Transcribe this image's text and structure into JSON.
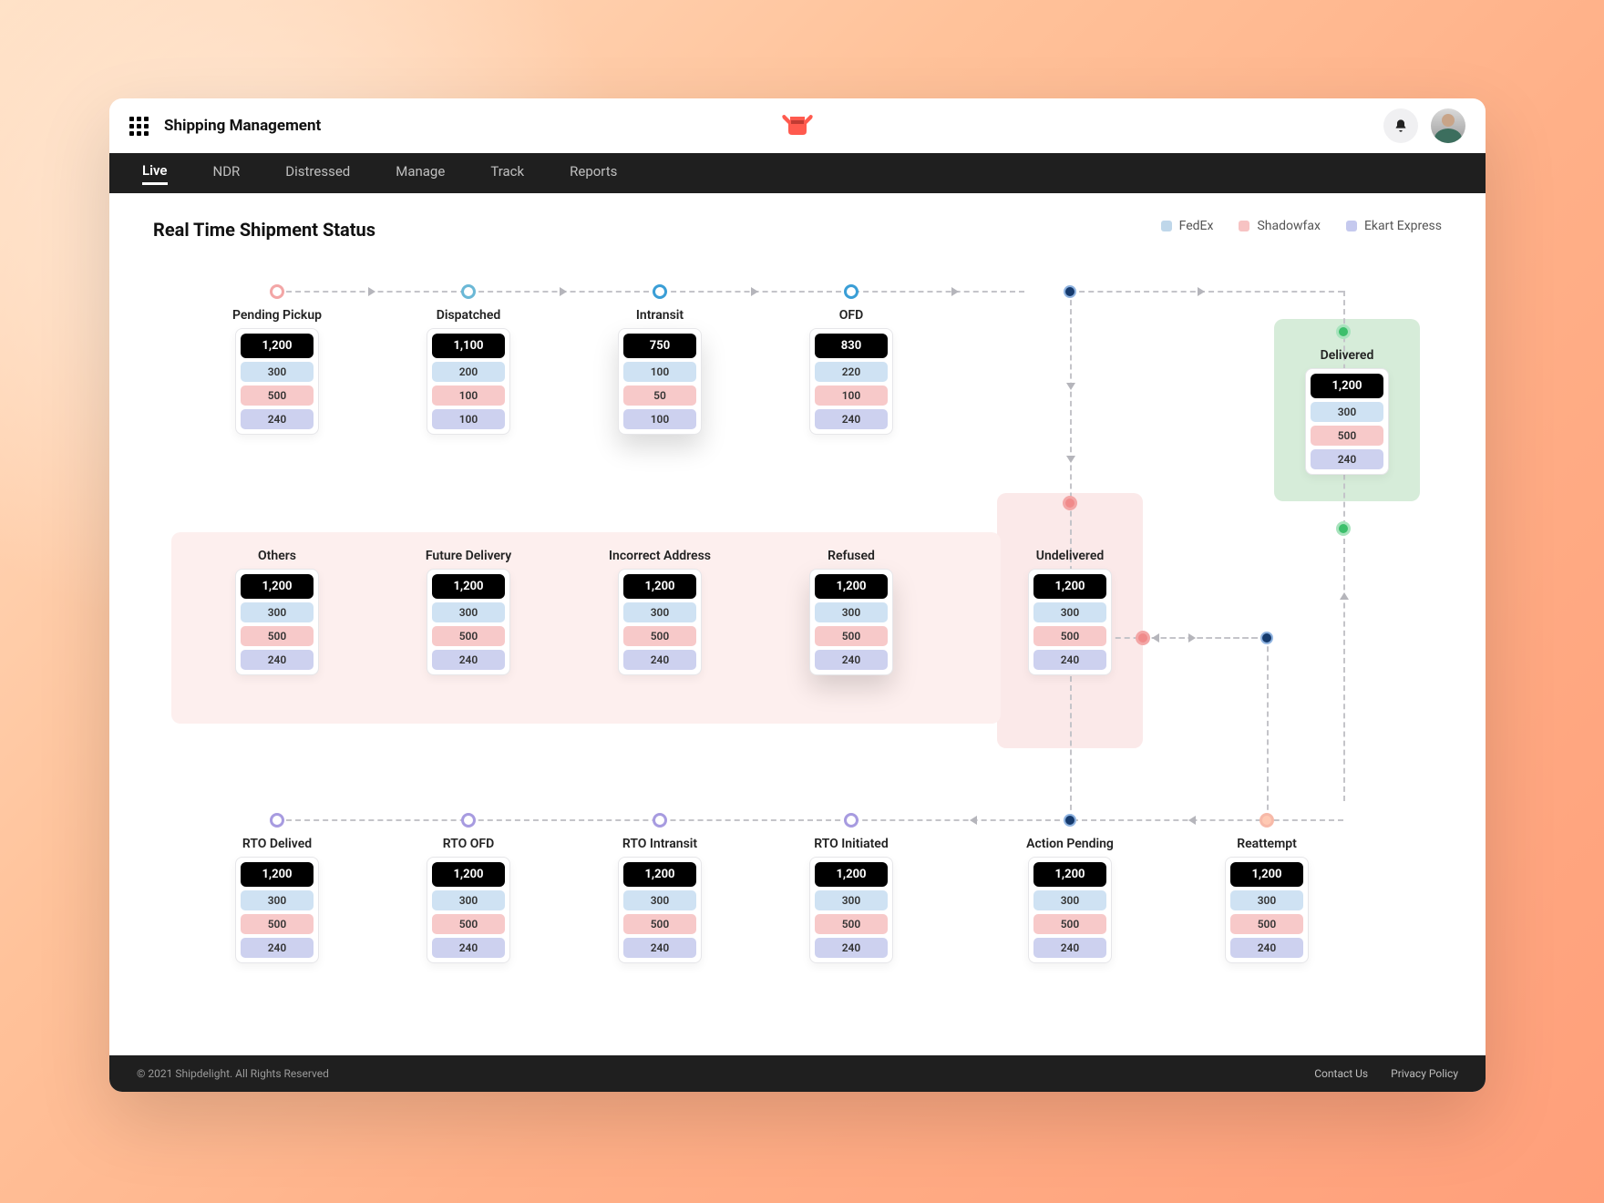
{
  "header": {
    "title": "Shipping Management"
  },
  "nav": {
    "live": "Live",
    "ndr": "NDR",
    "distressed": "Distressed",
    "manage": "Manage",
    "track": "Track",
    "reports": "Reports"
  },
  "section": {
    "title": "Real Time Shipment Status"
  },
  "legend": {
    "fedex": "FedEx",
    "shadowfax": "Shadowfax",
    "ekart": "Ekart Express"
  },
  "row1": {
    "pending": {
      "label": "Pending Pickup",
      "total": "1,200",
      "fedex": "300",
      "shadowfax": "500",
      "ekart": "240"
    },
    "dispatched": {
      "label": "Dispatched",
      "total": "1,100",
      "fedex": "200",
      "shadowfax": "100",
      "ekart": "100"
    },
    "intransit": {
      "label": "Intransit",
      "total": "750",
      "fedex": "100",
      "shadowfax": "50",
      "ekart": "100"
    },
    "ofd": {
      "label": "OFD",
      "total": "830",
      "fedex": "220",
      "shadowfax": "100",
      "ekart": "240"
    }
  },
  "delivered": {
    "label": "Delivered",
    "total": "1,200",
    "fedex": "300",
    "shadowfax": "500",
    "ekart": "240"
  },
  "row2": {
    "others": {
      "label": "Others",
      "total": "1,200",
      "fedex": "300",
      "shadowfax": "500",
      "ekart": "240"
    },
    "future": {
      "label": "Future Delivery",
      "total": "1,200",
      "fedex": "300",
      "shadowfax": "500",
      "ekart": "240"
    },
    "incorrect": {
      "label": "Incorrect Address",
      "total": "1,200",
      "fedex": "300",
      "shadowfax": "500",
      "ekart": "240"
    },
    "refused": {
      "label": "Refused",
      "total": "1,200",
      "fedex": "300",
      "shadowfax": "500",
      "ekart": "240"
    },
    "undelivered": {
      "label": "Undelivered",
      "total": "1,200",
      "fedex": "300",
      "shadowfax": "500",
      "ekart": "240"
    }
  },
  "row3": {
    "rtodel": {
      "label": "RTO Delived",
      "total": "1,200",
      "fedex": "300",
      "shadowfax": "500",
      "ekart": "240"
    },
    "rtoofd": {
      "label": "RTO OFD",
      "total": "1,200",
      "fedex": "300",
      "shadowfax": "500",
      "ekart": "240"
    },
    "rtoint": {
      "label": "RTO Intransit",
      "total": "1,200",
      "fedex": "300",
      "shadowfax": "500",
      "ekart": "240"
    },
    "rtoinit": {
      "label": "RTO Initiated",
      "total": "1,200",
      "fedex": "300",
      "shadowfax": "500",
      "ekart": "240"
    },
    "action": {
      "label": "Action Pending",
      "total": "1,200",
      "fedex": "300",
      "shadowfax": "500",
      "ekart": "240"
    },
    "reattempt": {
      "label": "Reattempt",
      "total": "1,200",
      "fedex": "300",
      "shadowfax": "500",
      "ekart": "240"
    }
  },
  "footer": {
    "copyright": "© 2021 Shipdelight. All Rights Reserved",
    "contact": "Contact Us",
    "privacy": "Privacy Policy"
  }
}
